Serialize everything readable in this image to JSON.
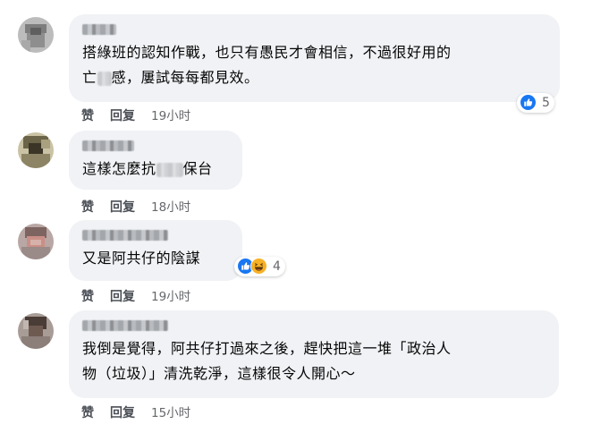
{
  "actions": {
    "like": "赞",
    "reply": "回复"
  },
  "comments": [
    {
      "text_line1": "搭綠班的認知作戰，也只有愚民才會相信，不過很好用的",
      "text_line2_a": "亡",
      "text_line2_b": "感，屢試每每都見效。",
      "time": "19小时",
      "reaction_count": "5",
      "reaction_icons": [
        "like-icon"
      ]
    },
    {
      "text_a": "這樣怎麼抗",
      "text_b": "保台",
      "time": "18小时"
    },
    {
      "text": "又是阿共仔的陰謀",
      "time": "19小时",
      "reaction_count": "4",
      "reaction_icons": [
        "like-icon",
        "haha-icon"
      ]
    },
    {
      "text_line1": "我倒是覺得，阿共仔打過來之後，趕快把這一堆「政治人",
      "text_line2": "物（垃圾）」清洗乾淨，這樣很令人開心～",
      "time": "15小时"
    }
  ],
  "colors": {
    "like_blue": "#1877f2",
    "haha_yellow": "#f7b125",
    "bubble_bg": "#f0f2f5"
  }
}
